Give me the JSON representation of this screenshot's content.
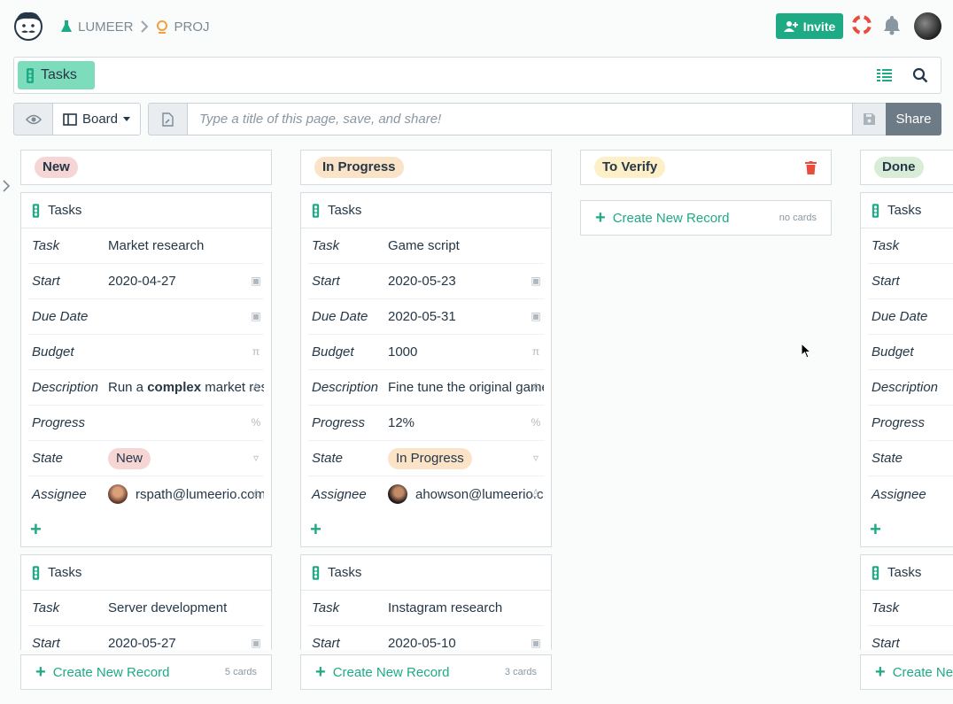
{
  "breadcrumb": {
    "workspace": "LUMEER",
    "project": "PROJ"
  },
  "header": {
    "invite_label": "Invite"
  },
  "search": {
    "chip_label": "Tasks"
  },
  "toolbar": {
    "view_label": "Board",
    "title_placeholder": "Type a title of this page, save, and share!",
    "share_label": "Share"
  },
  "columns": [
    {
      "label": "New",
      "badge_color": "#f6d5d5",
      "footer": {
        "create_label": "Create New Record",
        "count": "5 cards"
      },
      "cards": [
        {
          "title": "Tasks",
          "rows": [
            {
              "label": "Task",
              "value": "Market research"
            },
            {
              "label": "Start",
              "value": "2020-04-27"
            },
            {
              "label": "Due Date",
              "value": ""
            },
            {
              "label": "Budget",
              "value": ""
            },
            {
              "label": "Description",
              "value_pre": "Run a ",
              "value_bold": "complex",
              "value_post": " market research"
            },
            {
              "label": "Progress",
              "value": ""
            },
            {
              "label": "State",
              "value": "New"
            },
            {
              "label": "Assignee",
              "value": "rspath@lumeerio.com"
            }
          ]
        },
        {
          "title": "Tasks",
          "rows": [
            {
              "label": "Task",
              "value": "Server development"
            },
            {
              "label": "Start",
              "value": "2020-05-27"
            }
          ]
        }
      ]
    },
    {
      "label": "In Progress",
      "badge_color": "#fbe3c8",
      "footer": {
        "create_label": "Create New Record",
        "count": "3 cards"
      },
      "cards": [
        {
          "title": "Tasks",
          "rows": [
            {
              "label": "Task",
              "value": "Game script"
            },
            {
              "label": "Start",
              "value": "2020-05-23"
            },
            {
              "label": "Due Date",
              "value": "2020-05-31"
            },
            {
              "label": "Budget",
              "value": "1000"
            },
            {
              "label": "Description",
              "value": "Fine tune the original game script"
            },
            {
              "label": "Progress",
              "value": "12%"
            },
            {
              "label": "State",
              "value": "In Progress"
            },
            {
              "label": "Assignee",
              "value": "ahowson@lumeerio.com"
            }
          ]
        },
        {
          "title": "Tasks",
          "rows": [
            {
              "label": "Task",
              "value": "Instagram research"
            },
            {
              "label": "Start",
              "value": "2020-05-10"
            }
          ]
        }
      ]
    },
    {
      "label": "To Verify",
      "badge_color": "#fdefc8",
      "footer": {
        "create_label": "Create New Record",
        "count": "no cards"
      }
    },
    {
      "label": "Done",
      "badge_color": "#d8ecd8",
      "footer": {
        "create_label": "Create New Record"
      },
      "cards": [
        {
          "title": "Tasks",
          "rows": [
            {
              "label": "Task"
            },
            {
              "label": "Start"
            },
            {
              "label": "Due Date"
            },
            {
              "label": "Budget"
            },
            {
              "label": "Description"
            },
            {
              "label": "Progress"
            },
            {
              "label": "State"
            },
            {
              "label": "Assignee"
            }
          ]
        },
        {
          "title": "Tasks",
          "rows": [
            {
              "label": "Task"
            },
            {
              "label": "Start"
            }
          ]
        }
      ]
    }
  ]
}
